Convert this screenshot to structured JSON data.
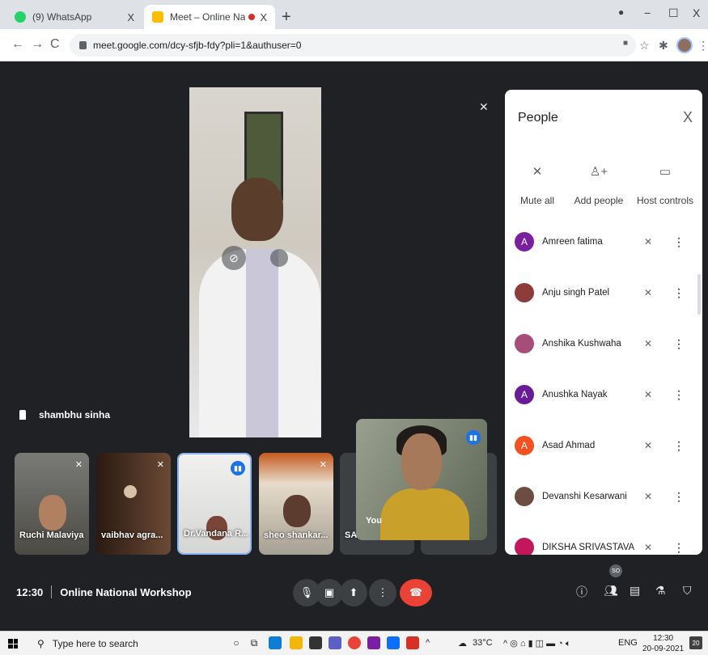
{
  "browser": {
    "tabs": [
      {
        "title": "(9) WhatsApp",
        "close": "X"
      },
      {
        "title": "Meet – Online National Wor",
        "close": "X"
      }
    ],
    "new_tab": "+",
    "window_controls": [
      "−",
      "☐",
      "X"
    ],
    "nav": {
      "back": "←",
      "forward": "→",
      "reload": "C"
    },
    "url": "meet.google.com/dcy-sfjb-fdy?pli=1&authuser=0"
  },
  "meet": {
    "main_speaker": "shambhu sinha",
    "filmstrip": [
      {
        "name": "Ruchi Malaviya",
        "muted": true
      },
      {
        "name": "vaibhav agra...",
        "muted": true
      },
      {
        "name": "Dr.Vandana R...",
        "speaking": true
      },
      {
        "name": "sheo shankar...",
        "muted": true
      },
      {
        "name": "SAI"
      }
    ],
    "self_label": "You",
    "time": "12:30",
    "meeting_title": "Online National Workshop",
    "participant_badge": "SO"
  },
  "people_panel": {
    "title": "People",
    "close": "X",
    "actions": [
      {
        "label": "Mute all"
      },
      {
        "label": "Add people"
      },
      {
        "label": "Host controls"
      }
    ],
    "participants": [
      {
        "name": "Amreen fatima",
        "initial": "A",
        "color": "#7b1fa2"
      },
      {
        "name": "Anju singh Patel",
        "initial": "",
        "color": "#8d3b3b"
      },
      {
        "name": "Anshika Kushwaha",
        "initial": "",
        "color": "#a64d79"
      },
      {
        "name": "Anushka Nayak",
        "initial": "A",
        "color": "#6a1b9a"
      },
      {
        "name": "Asad Ahmad",
        "initial": "A",
        "color": "#f4511e"
      },
      {
        "name": "Devanshi Kesarwani",
        "initial": "",
        "color": "#6d4c41"
      },
      {
        "name": "DIKSHA SRIVASTAVA",
        "initial": "",
        "color": "#c2185b"
      }
    ]
  },
  "taskbar": {
    "search_placeholder": "Type here to search",
    "weather": "33°C",
    "language": "ENG",
    "clock_time": "12:30",
    "clock_date": "20-09-2021",
    "notifications": "20"
  }
}
